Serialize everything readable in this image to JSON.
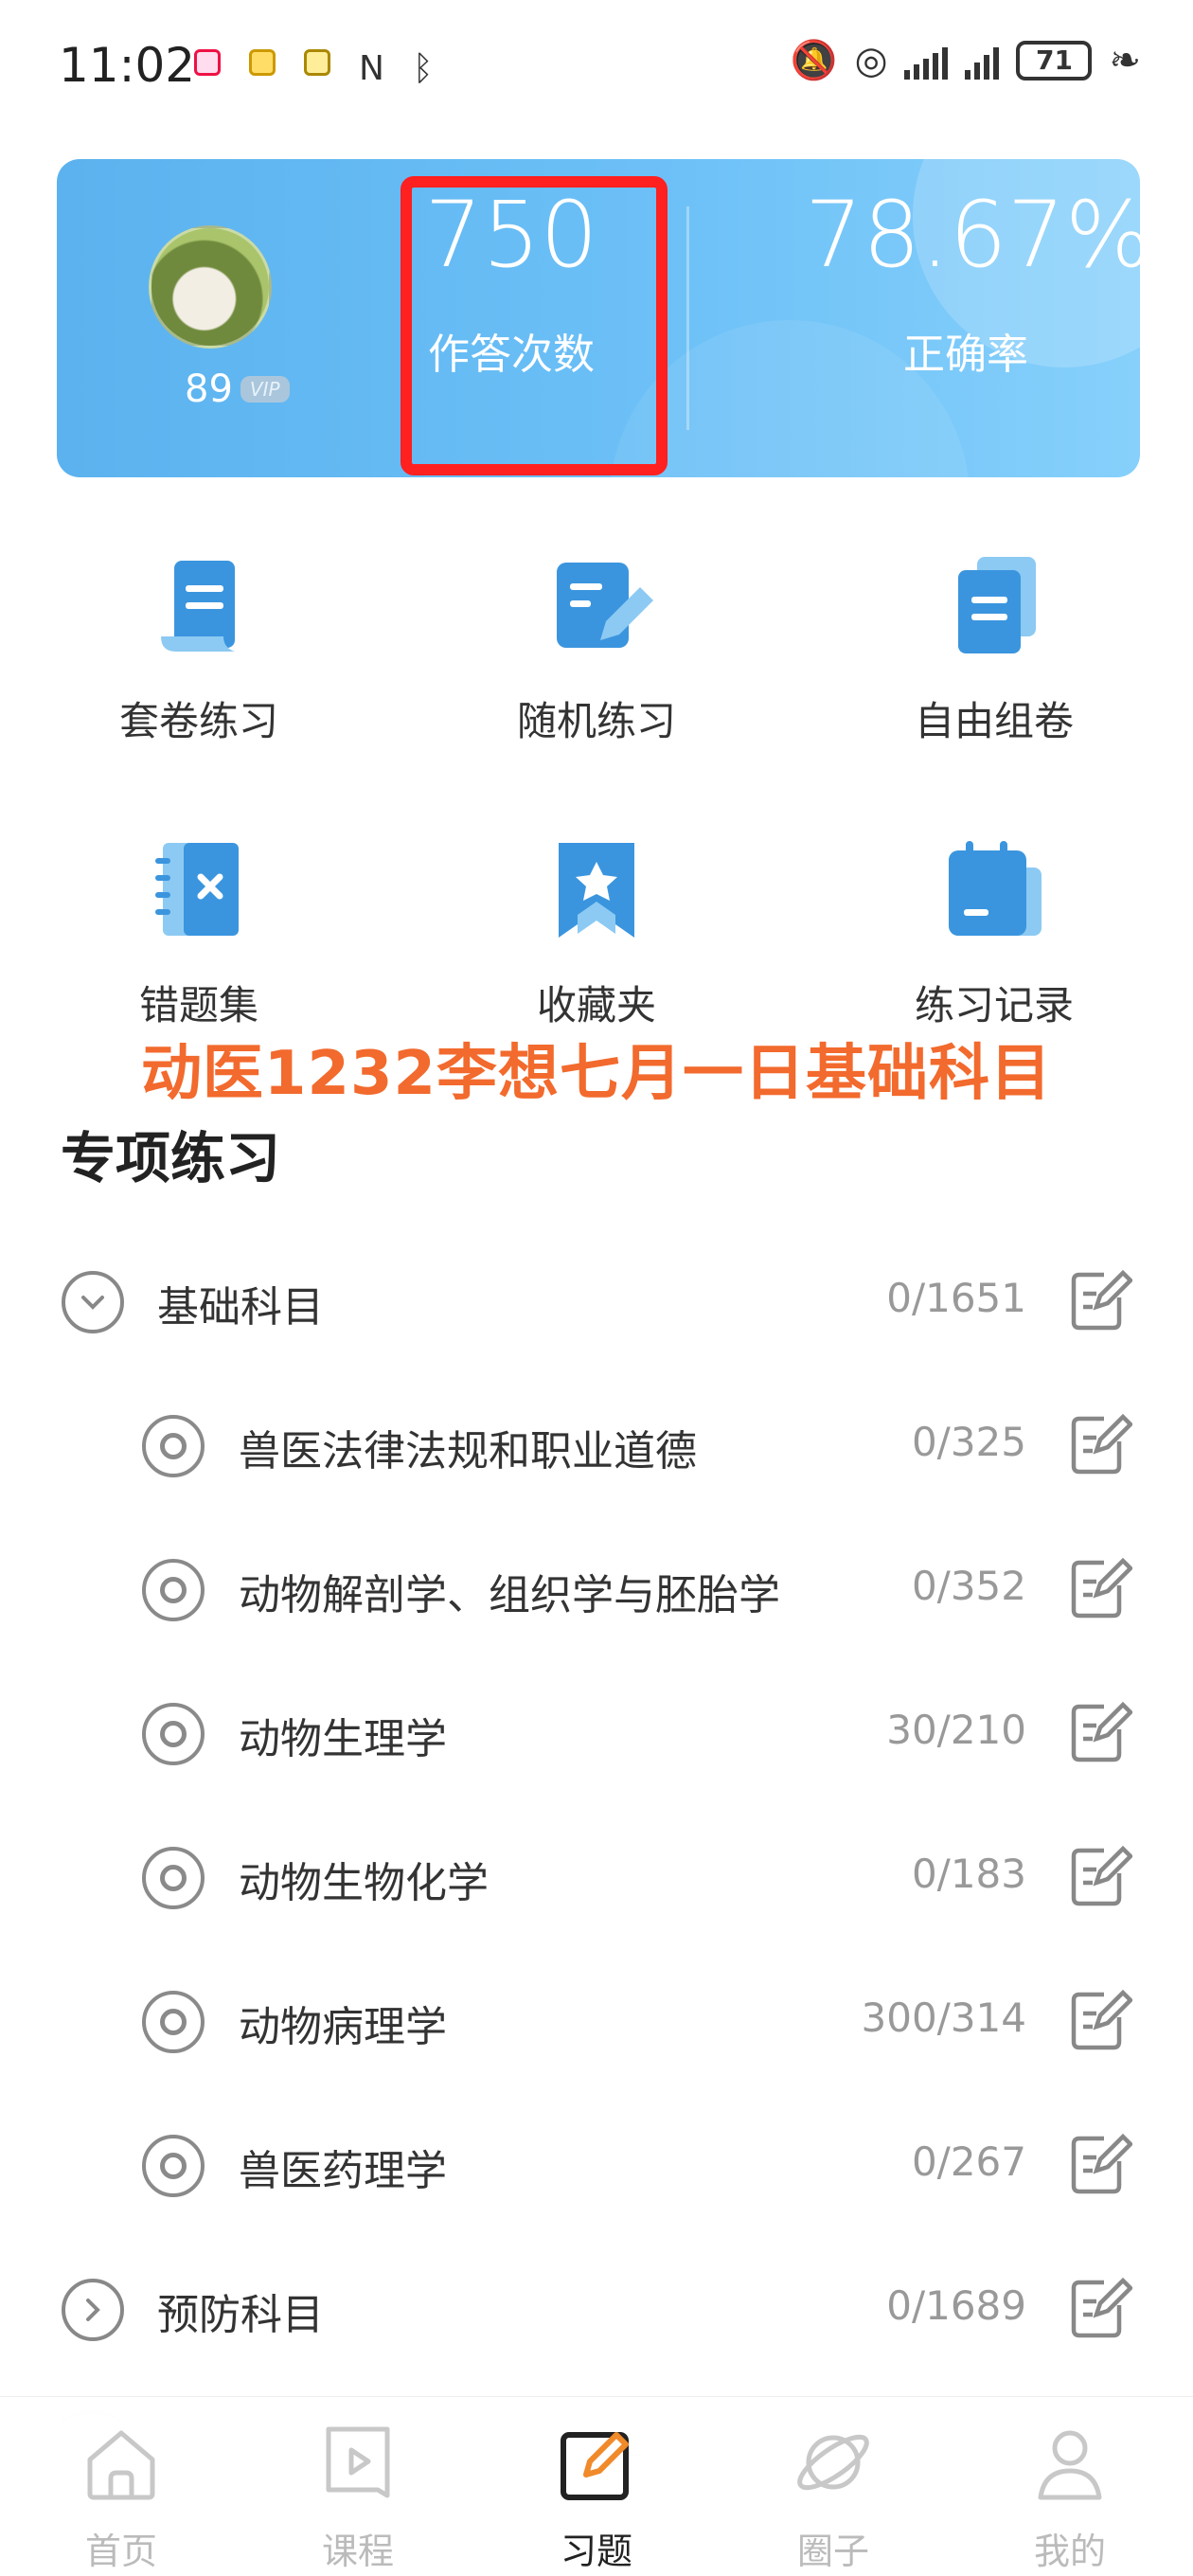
{
  "status_bar": {
    "time": "11:02",
    "battery": "71",
    "colors": {
      "text": "#333333"
    }
  },
  "hero": {
    "level": "89",
    "vip_badge": "VIP",
    "answer_count": "750",
    "answer_count_label": "作答次数",
    "accuracy": "78.67%",
    "accuracy_label": "正确率",
    "colors": {
      "gradient_start": "#5bb2ee",
      "gradient_end": "#86d0fb",
      "highlight_box": "#ff2020"
    }
  },
  "functions": [
    {
      "label": "套卷练习",
      "icon": "scroll-doc-icon"
    },
    {
      "label": "随机练习",
      "icon": "edit-doc-icon"
    },
    {
      "label": "自由组卷",
      "icon": "stack-doc-icon"
    },
    {
      "label": "错题集",
      "icon": "wrong-notebook-icon"
    },
    {
      "label": "收藏夹",
      "icon": "bookmark-star-icon"
    },
    {
      "label": "练习记录",
      "icon": "calendar-record-icon"
    }
  ],
  "watermark_text": "动医1232李想七月一日基础科目",
  "section_title": "专项练习",
  "subjects": [
    {
      "name": "基础科目",
      "count": "0/1651",
      "level": "top",
      "expanded": true
    },
    {
      "name": "兽医法律法规和职业道德",
      "count": "0/325",
      "level": "sub"
    },
    {
      "name": "动物解剖学、组织学与胚胎学",
      "count": "0/352",
      "level": "sub"
    },
    {
      "name": "动物生理学",
      "count": "30/210",
      "level": "sub"
    },
    {
      "name": "动物生物化学",
      "count": "0/183",
      "level": "sub"
    },
    {
      "name": "动物病理学",
      "count": "300/314",
      "level": "sub"
    },
    {
      "name": "兽医药理学",
      "count": "0/267",
      "level": "sub"
    },
    {
      "name": "预防科目",
      "count": "0/1689",
      "level": "top",
      "expanded": false
    }
  ],
  "bottom_nav": [
    {
      "label": "首页",
      "icon": "home-icon",
      "active": false
    },
    {
      "label": "课程",
      "icon": "play-course-icon",
      "active": false
    },
    {
      "label": "习题",
      "icon": "edit-exercise-icon",
      "active": true
    },
    {
      "label": "圈子",
      "icon": "planet-icon",
      "active": false
    },
    {
      "label": "我的",
      "icon": "profile-icon",
      "active": false
    }
  ],
  "colors": {
    "accent": "#4aa8ec",
    "orange": "#f26a2d",
    "active_nav": "#f08a2a"
  }
}
